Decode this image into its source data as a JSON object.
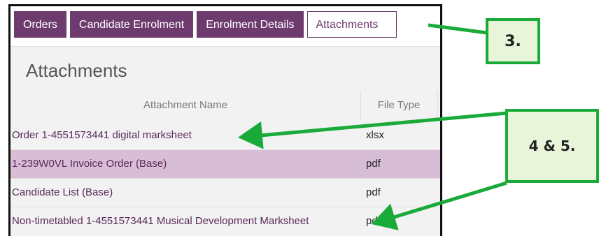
{
  "tabs": [
    {
      "label": "Orders"
    },
    {
      "label": "Candidate Enrolment"
    },
    {
      "label": "Enrolment Details"
    },
    {
      "label": "Attachments"
    }
  ],
  "panel": {
    "title": "Attachments"
  },
  "table": {
    "columns": [
      "Attachment Name",
      "File Type"
    ],
    "rows": [
      {
        "name": "Order 1-4551573441 digital marksheet",
        "type": "xlsx"
      },
      {
        "name": "1-239W0VL Invoice Order (Base)",
        "type": "pdf"
      },
      {
        "name": "Candidate List (Base)",
        "type": "pdf"
      },
      {
        "name": "Non-timetabled 1-4551573441 Musical Development Marksheet",
        "type": "pdf"
      }
    ]
  },
  "callouts": {
    "step3": "3.",
    "step45": "4 & 5."
  },
  "colors": {
    "tab_purple": "#6e3b6e",
    "highlight_row": "#d8bdd6",
    "callout_green": "#1aaa3a",
    "callout_fill": "#e9f5d9"
  }
}
